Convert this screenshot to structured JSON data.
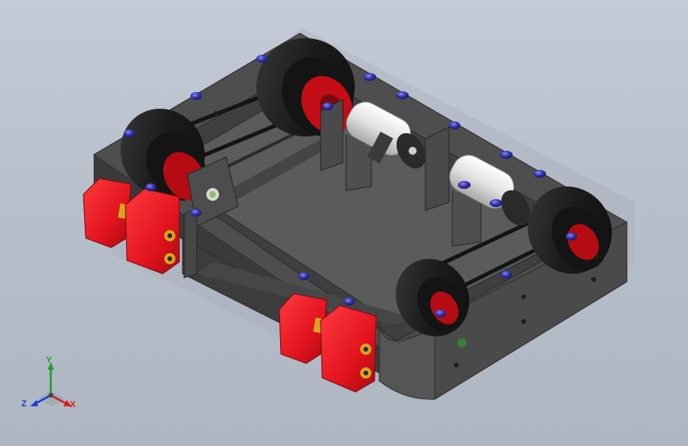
{
  "viewport": {
    "background_top": "#c4cbd6",
    "background_bottom": "#aeb6c2"
  },
  "model": {
    "frame_color": "#4a4a4b",
    "frame_dark_color": "#353536",
    "floor_color": "#5a5a5b",
    "wheel_color": "#1b1b1c",
    "hub_color": "#d10c16",
    "bumper_color": "#e3141e",
    "screw_color": "#2a2a9a",
    "motor_color": "#e6e6e6",
    "brass_color": "#d9a421"
  },
  "triad": {
    "x_label": "X",
    "y_label": "Y",
    "z_label": "Z",
    "x_color": "#d21f1f",
    "y_color": "#1e9e2e",
    "z_color": "#1f3fd2"
  }
}
